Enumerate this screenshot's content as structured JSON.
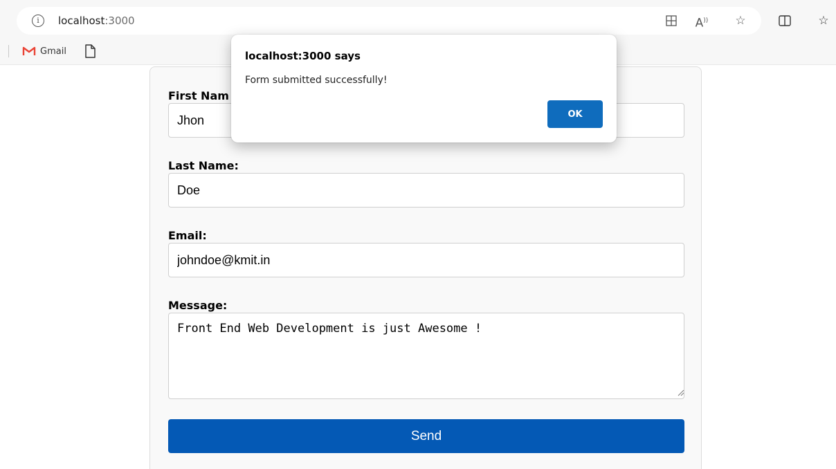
{
  "browser": {
    "url_host": "localhost",
    "url_port": ":3000",
    "bookmarks": [
      {
        "label": "Gmail",
        "icon": "gmail-icon"
      },
      {
        "label": "",
        "icon": "document-icon"
      }
    ]
  },
  "form": {
    "first_name": {
      "label": "First Nam",
      "value": "Jhon"
    },
    "last_name": {
      "label": "Last Name:",
      "value": "Doe"
    },
    "email": {
      "label": "Email:",
      "value": "johndoe@kmit.in"
    },
    "message": {
      "label": "Message:",
      "value": "Front End Web Development is just Awesome !"
    },
    "send_label": "Send"
  },
  "dialog": {
    "title": "localhost:3000 says",
    "message": "Form submitted successfully!",
    "ok_label": "OK"
  },
  "colors": {
    "send_button": "#0459b5",
    "ok_button": "#0f6cbd",
    "gmail_red": "#ea4335"
  }
}
